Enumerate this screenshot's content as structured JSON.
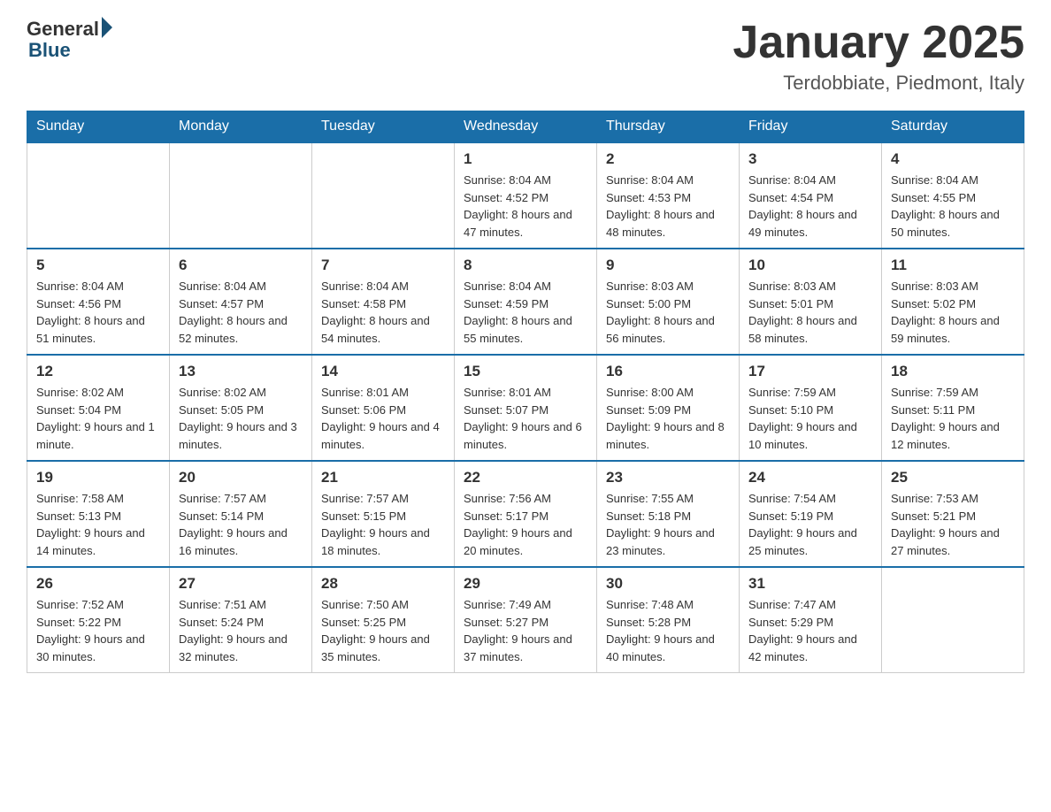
{
  "header": {
    "logo_general": "General",
    "logo_blue": "Blue",
    "month_title": "January 2025",
    "location": "Terdobbiate, Piedmont, Italy"
  },
  "days_of_week": [
    "Sunday",
    "Monday",
    "Tuesday",
    "Wednesday",
    "Thursday",
    "Friday",
    "Saturday"
  ],
  "weeks": [
    [
      {
        "day": "",
        "info": ""
      },
      {
        "day": "",
        "info": ""
      },
      {
        "day": "",
        "info": ""
      },
      {
        "day": "1",
        "info": "Sunrise: 8:04 AM\nSunset: 4:52 PM\nDaylight: 8 hours\nand 47 minutes."
      },
      {
        "day": "2",
        "info": "Sunrise: 8:04 AM\nSunset: 4:53 PM\nDaylight: 8 hours\nand 48 minutes."
      },
      {
        "day": "3",
        "info": "Sunrise: 8:04 AM\nSunset: 4:54 PM\nDaylight: 8 hours\nand 49 minutes."
      },
      {
        "day": "4",
        "info": "Sunrise: 8:04 AM\nSunset: 4:55 PM\nDaylight: 8 hours\nand 50 minutes."
      }
    ],
    [
      {
        "day": "5",
        "info": "Sunrise: 8:04 AM\nSunset: 4:56 PM\nDaylight: 8 hours\nand 51 minutes."
      },
      {
        "day": "6",
        "info": "Sunrise: 8:04 AM\nSunset: 4:57 PM\nDaylight: 8 hours\nand 52 minutes."
      },
      {
        "day": "7",
        "info": "Sunrise: 8:04 AM\nSunset: 4:58 PM\nDaylight: 8 hours\nand 54 minutes."
      },
      {
        "day": "8",
        "info": "Sunrise: 8:04 AM\nSunset: 4:59 PM\nDaylight: 8 hours\nand 55 minutes."
      },
      {
        "day": "9",
        "info": "Sunrise: 8:03 AM\nSunset: 5:00 PM\nDaylight: 8 hours\nand 56 minutes."
      },
      {
        "day": "10",
        "info": "Sunrise: 8:03 AM\nSunset: 5:01 PM\nDaylight: 8 hours\nand 58 minutes."
      },
      {
        "day": "11",
        "info": "Sunrise: 8:03 AM\nSunset: 5:02 PM\nDaylight: 8 hours\nand 59 minutes."
      }
    ],
    [
      {
        "day": "12",
        "info": "Sunrise: 8:02 AM\nSunset: 5:04 PM\nDaylight: 9 hours\nand 1 minute."
      },
      {
        "day": "13",
        "info": "Sunrise: 8:02 AM\nSunset: 5:05 PM\nDaylight: 9 hours\nand 3 minutes."
      },
      {
        "day": "14",
        "info": "Sunrise: 8:01 AM\nSunset: 5:06 PM\nDaylight: 9 hours\nand 4 minutes."
      },
      {
        "day": "15",
        "info": "Sunrise: 8:01 AM\nSunset: 5:07 PM\nDaylight: 9 hours\nand 6 minutes."
      },
      {
        "day": "16",
        "info": "Sunrise: 8:00 AM\nSunset: 5:09 PM\nDaylight: 9 hours\nand 8 minutes."
      },
      {
        "day": "17",
        "info": "Sunrise: 7:59 AM\nSunset: 5:10 PM\nDaylight: 9 hours\nand 10 minutes."
      },
      {
        "day": "18",
        "info": "Sunrise: 7:59 AM\nSunset: 5:11 PM\nDaylight: 9 hours\nand 12 minutes."
      }
    ],
    [
      {
        "day": "19",
        "info": "Sunrise: 7:58 AM\nSunset: 5:13 PM\nDaylight: 9 hours\nand 14 minutes."
      },
      {
        "day": "20",
        "info": "Sunrise: 7:57 AM\nSunset: 5:14 PM\nDaylight: 9 hours\nand 16 minutes."
      },
      {
        "day": "21",
        "info": "Sunrise: 7:57 AM\nSunset: 5:15 PM\nDaylight: 9 hours\nand 18 minutes."
      },
      {
        "day": "22",
        "info": "Sunrise: 7:56 AM\nSunset: 5:17 PM\nDaylight: 9 hours\nand 20 minutes."
      },
      {
        "day": "23",
        "info": "Sunrise: 7:55 AM\nSunset: 5:18 PM\nDaylight: 9 hours\nand 23 minutes."
      },
      {
        "day": "24",
        "info": "Sunrise: 7:54 AM\nSunset: 5:19 PM\nDaylight: 9 hours\nand 25 minutes."
      },
      {
        "day": "25",
        "info": "Sunrise: 7:53 AM\nSunset: 5:21 PM\nDaylight: 9 hours\nand 27 minutes."
      }
    ],
    [
      {
        "day": "26",
        "info": "Sunrise: 7:52 AM\nSunset: 5:22 PM\nDaylight: 9 hours\nand 30 minutes."
      },
      {
        "day": "27",
        "info": "Sunrise: 7:51 AM\nSunset: 5:24 PM\nDaylight: 9 hours\nand 32 minutes."
      },
      {
        "day": "28",
        "info": "Sunrise: 7:50 AM\nSunset: 5:25 PM\nDaylight: 9 hours\nand 35 minutes."
      },
      {
        "day": "29",
        "info": "Sunrise: 7:49 AM\nSunset: 5:27 PM\nDaylight: 9 hours\nand 37 minutes."
      },
      {
        "day": "30",
        "info": "Sunrise: 7:48 AM\nSunset: 5:28 PM\nDaylight: 9 hours\nand 40 minutes."
      },
      {
        "day": "31",
        "info": "Sunrise: 7:47 AM\nSunset: 5:29 PM\nDaylight: 9 hours\nand 42 minutes."
      },
      {
        "day": "",
        "info": ""
      }
    ]
  ]
}
